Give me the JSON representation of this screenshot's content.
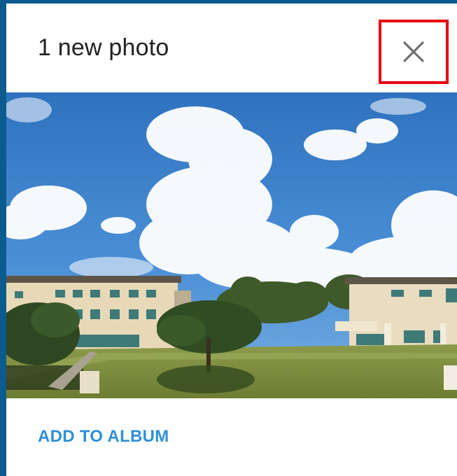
{
  "dialog": {
    "title": "1 new photo",
    "close_icon": "close-icon",
    "action_label": "ADD TO ALBUM"
  },
  "photo": {
    "subject": "campus-buildings-under-blue-sky"
  },
  "colors": {
    "frame": "#0b5b8f",
    "card": "#ffffff",
    "title": "#212121",
    "action": "#2f8fd8",
    "highlight": "#e60012",
    "sky": "#3a7fc8"
  }
}
